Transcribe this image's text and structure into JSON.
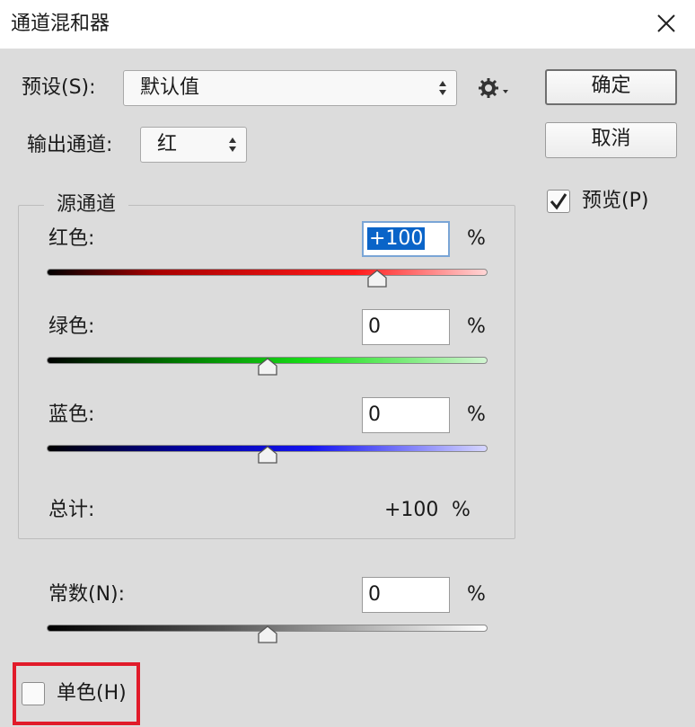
{
  "window": {
    "title": "通道混和器",
    "close_icon": "close-icon"
  },
  "preset": {
    "label": "预设(S):",
    "value": "默认值",
    "menu_icon": "gear-icon"
  },
  "output_channel": {
    "label": "输出通道:",
    "value": "红"
  },
  "buttons": {
    "ok": "确定",
    "cancel": "取消"
  },
  "preview": {
    "label": "预览(P)",
    "checked": true
  },
  "source_channels": {
    "legend": "源通道",
    "channels": [
      {
        "label": "红色:",
        "value": "+100",
        "unit": "%",
        "level": 100,
        "color": "#ff0000"
      },
      {
        "label": "绿色:",
        "value": "0",
        "unit": "%",
        "level": 0,
        "color": "#00ff00"
      },
      {
        "label": "蓝色:",
        "value": "0",
        "unit": "%",
        "level": 0,
        "color": "#0000ff"
      }
    ],
    "total": {
      "label": "总计:",
      "value": "+100",
      "unit": "%"
    }
  },
  "constant": {
    "label": "常数(N):",
    "value": "0",
    "unit": "%",
    "level": 0
  },
  "monochrome": {
    "label": "单色(H)",
    "checked": false
  },
  "colors": {
    "highlight": "#e11b2a",
    "selection": "#0a64c8"
  }
}
